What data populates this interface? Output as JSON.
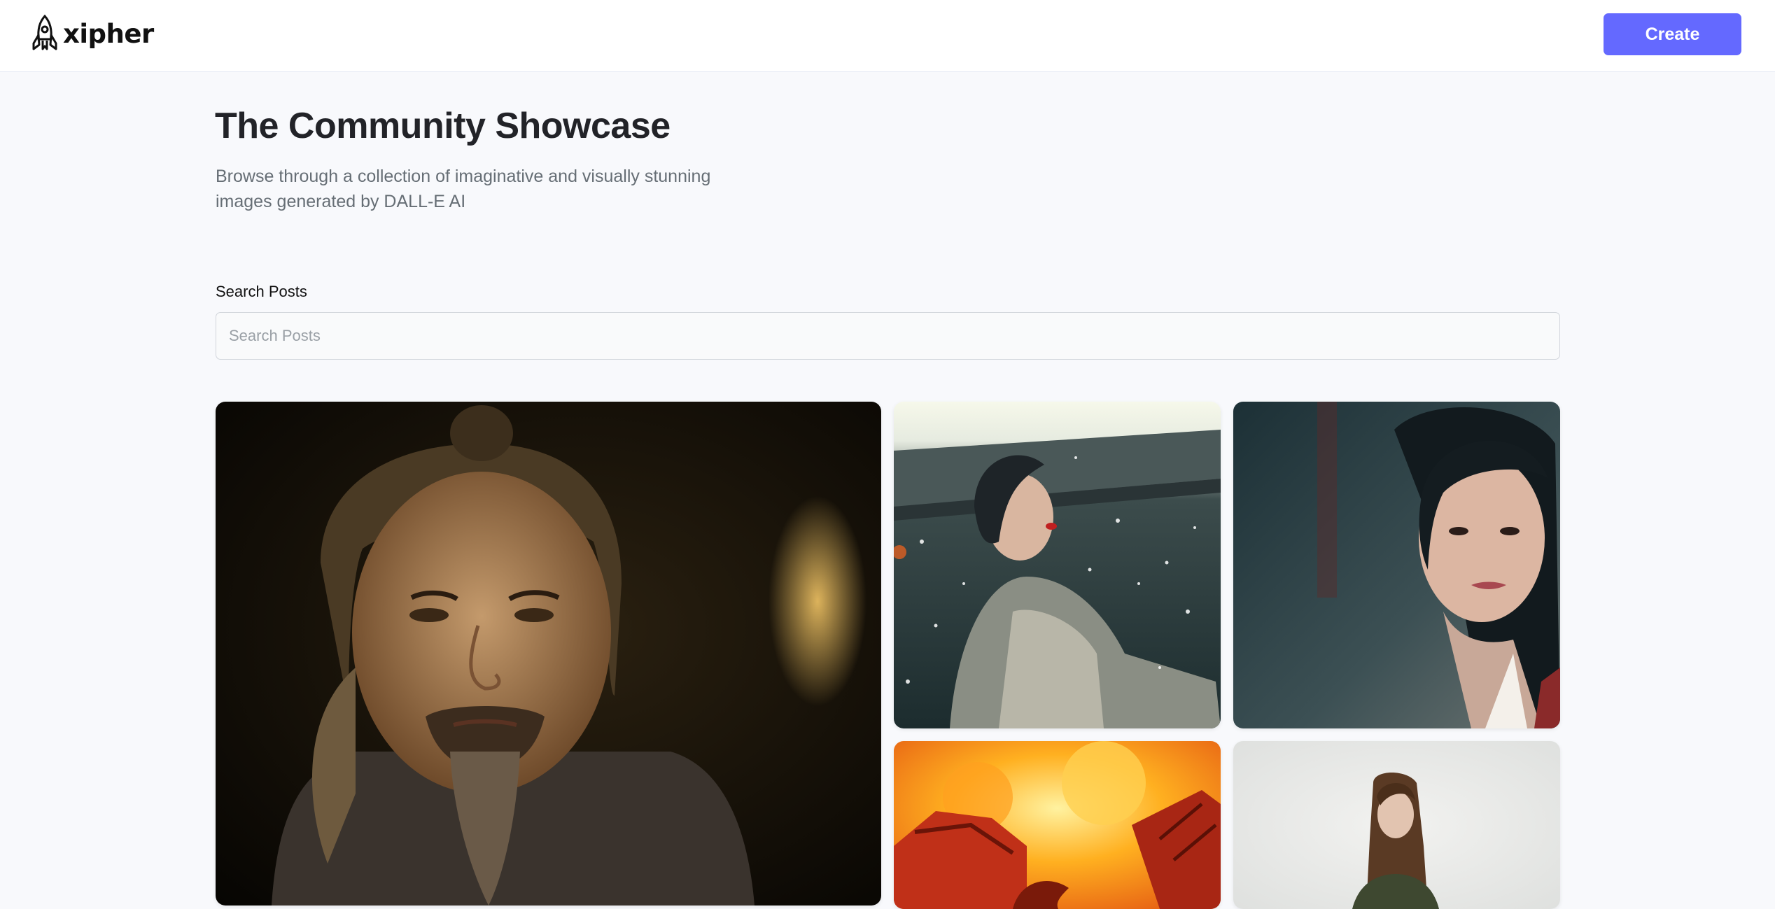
{
  "header": {
    "logo_text": "xipher",
    "create_label": "Create"
  },
  "hero": {
    "title": "The Community Showcase",
    "subtitle": "Browse through a collection of imaginative and visually stunning images generated by DALL-E AI"
  },
  "search": {
    "label": "Search Posts",
    "placeholder": "Search Posts",
    "value": ""
  },
  "gallery": {
    "items": [
      {
        "subject": "portrait of an older man with topknot and goatee"
      },
      {
        "subject": "woman in silver robe in falling snow"
      },
      {
        "subject": "young woman with dark hair portrait"
      },
      {
        "subject": "red dragon wing against flames"
      },
      {
        "subject": "woman with long brown hair on white background"
      }
    ]
  },
  "colors": {
    "accent": "#6469ff",
    "background": "#f8f9fc",
    "title": "#222328",
    "subtitle": "#666e75"
  }
}
